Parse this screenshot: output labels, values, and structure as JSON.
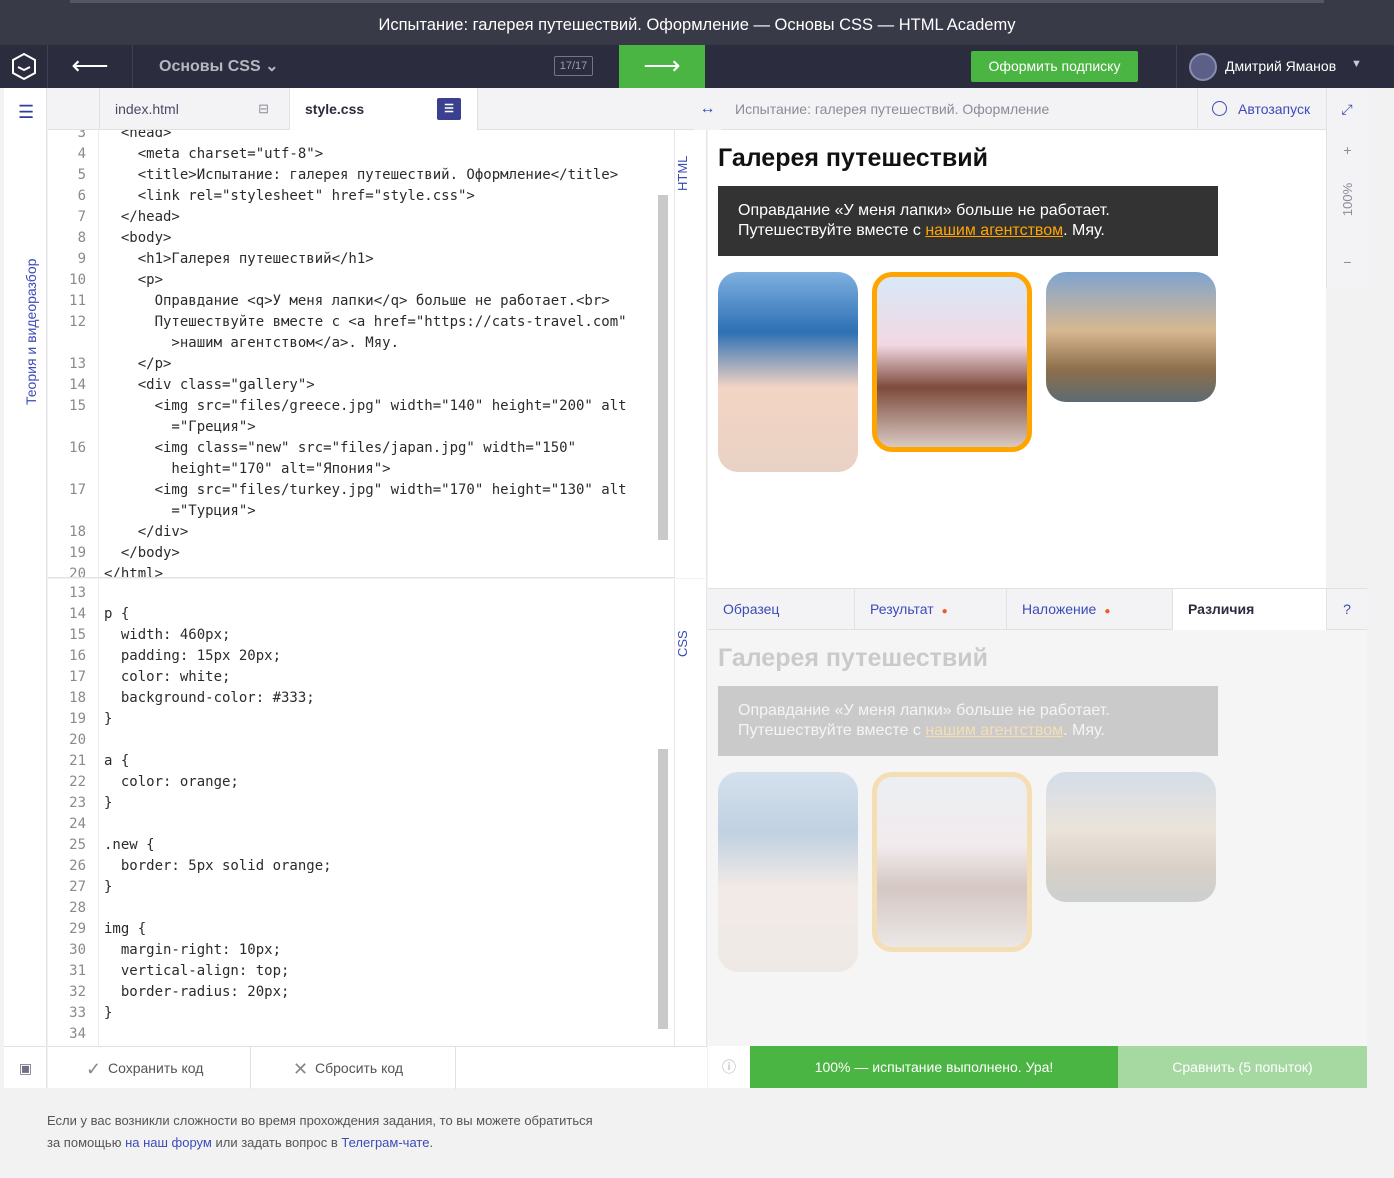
{
  "window_title": "Испытание: галерея путешествий. Оформление — Основы CSS — HTML Academy",
  "nav": {
    "back": "⟵",
    "course": "Основы CSS",
    "counter": "17/17",
    "next": "⟶",
    "subscribe": "Оформить подписку",
    "user": "Дмитрий Яманов"
  },
  "sidebar": {
    "label": "Теория и видеоразбор"
  },
  "tabs": {
    "index": "index.html",
    "style": "style.css"
  },
  "labels": {
    "html": "HTML",
    "css": "CSS"
  },
  "html_lines": [
    {
      "n": "3",
      "code": "  <head>"
    },
    {
      "n": "4",
      "code": "    <meta charset=\"utf-8\">"
    },
    {
      "n": "5",
      "code": "    <title>Испытание: галерея путешествий. Оформление</title>"
    },
    {
      "n": "6",
      "code": "    <link rel=\"stylesheet\" href=\"style.css\">"
    },
    {
      "n": "7",
      "code": "  </head>"
    },
    {
      "n": "8",
      "code": "  <body>"
    },
    {
      "n": "9",
      "code": "    <h1>Галерея путешествий</h1>"
    },
    {
      "n": "10",
      "code": "    <p>"
    },
    {
      "n": "11",
      "code": "      Оправдание <q>У меня лапки</q> больше не работает.<br>"
    },
    {
      "n": "12",
      "code": "      Путешествуйте вместе с <a href=\"https://cats-travel.com\""
    },
    {
      "n": "",
      "code": "        >нашим агентством</a>. Мяу."
    },
    {
      "n": "13",
      "code": "    </p>"
    },
    {
      "n": "14",
      "code": "    <div class=\"gallery\">"
    },
    {
      "n": "15",
      "code": "      <img src=\"files/greece.jpg\" width=\"140\" height=\"200\" alt"
    },
    {
      "n": "",
      "code": "        =\"Греция\">"
    },
    {
      "n": "16",
      "code": "      <img class=\"new\" src=\"files/japan.jpg\" width=\"150\""
    },
    {
      "n": "",
      "code": "        height=\"170\" alt=\"Япония\">"
    },
    {
      "n": "17",
      "code": "      <img src=\"files/turkey.jpg\" width=\"170\" height=\"130\" alt"
    },
    {
      "n": "",
      "code": "        =\"Турция\">"
    },
    {
      "n": "18",
      "code": "    </div>"
    },
    {
      "n": "19",
      "code": "  </body>"
    },
    {
      "n": "20",
      "code": "</html>"
    }
  ],
  "css_lines": [
    {
      "n": "13",
      "code": ""
    },
    {
      "n": "14",
      "code": "p {"
    },
    {
      "n": "15",
      "code": "  width: 460px;"
    },
    {
      "n": "16",
      "code": "  padding: 15px 20px;"
    },
    {
      "n": "17",
      "code": "  color: white;"
    },
    {
      "n": "18",
      "code": "  background-color: #333;"
    },
    {
      "n": "19",
      "code": "}"
    },
    {
      "n": "20",
      "code": ""
    },
    {
      "n": "21",
      "code": "a {"
    },
    {
      "n": "22",
      "code": "  color: orange;"
    },
    {
      "n": "23",
      "code": "}"
    },
    {
      "n": "24",
      "code": ""
    },
    {
      "n": "25",
      "code": ".new {"
    },
    {
      "n": "26",
      "code": "  border: 5px solid orange;"
    },
    {
      "n": "27",
      "code": "}"
    },
    {
      "n": "28",
      "code": ""
    },
    {
      "n": "29",
      "code": "img {"
    },
    {
      "n": "30",
      "code": "  margin-right: 10px;"
    },
    {
      "n": "31",
      "code": "  vertical-align: top;"
    },
    {
      "n": "32",
      "code": "  border-radius: 20px;"
    },
    {
      "n": "33",
      "code": "}"
    },
    {
      "n": "34",
      "code": ""
    }
  ],
  "preview": {
    "toolbar_title": "Испытание: галерея путешествий. Оформление",
    "autorun": "Автозапуск",
    "zoom": "100%",
    "heading": "Галерея путешествий",
    "text1": "Оправдание «У меня лапки» больше не работает.",
    "text2": "Путешествуйте вместе с ",
    "link": "нашим агентством",
    "text3": ". Мяу.",
    "tabs": [
      "Образец",
      "Результат",
      "Наложение",
      "Различия",
      "?"
    ]
  },
  "bottom": {
    "save": "Сохранить код",
    "reset": "Сбросить код",
    "success": "100% — испытание выполнено. Ура!",
    "compare": "Сравнить (5 попыток)"
  },
  "footer": {
    "text1": "Если у вас возникли сложности во время прохождения задания, то вы можете обратиться",
    "text2": "за помощью ",
    "forum": "на наш форум",
    "text3": " или задать вопрос в ",
    "telegram": "Телеграм-чате",
    "text4": "."
  },
  "colors": {
    "accent": "#4bb543",
    "nav": "#2b2c3d",
    "link": "#3b4bb8",
    "orange": "#ffa500"
  },
  "icons": [
    "logo-icon",
    "back-arrow-icon",
    "chevron-down-icon",
    "next-arrow-icon",
    "avatar-icon",
    "menu-icon",
    "split-icon",
    "swap-icon",
    "autorun-icon",
    "expand-icon",
    "plus-icon",
    "minus-icon",
    "check-icon",
    "close-icon",
    "info-icon",
    "chat-icon"
  ]
}
